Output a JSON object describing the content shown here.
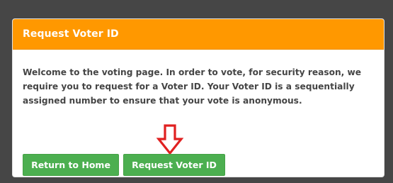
{
  "panel": {
    "title": "Request Voter ID",
    "message": "Welcome to the voting page. In order to vote, for security reason, we require you to request for a Voter ID. Your Voter ID is a sequentially assigned number to ensure that your vote is anonymous."
  },
  "annotation": {
    "icon": "arrow-down-outline-icon",
    "color": "#e02020"
  },
  "buttons": {
    "home_label": "Return to Home",
    "request_label": "Request Voter ID"
  },
  "colors": {
    "header": "#ff9800",
    "button": "#4caf50",
    "background": "#464646"
  }
}
